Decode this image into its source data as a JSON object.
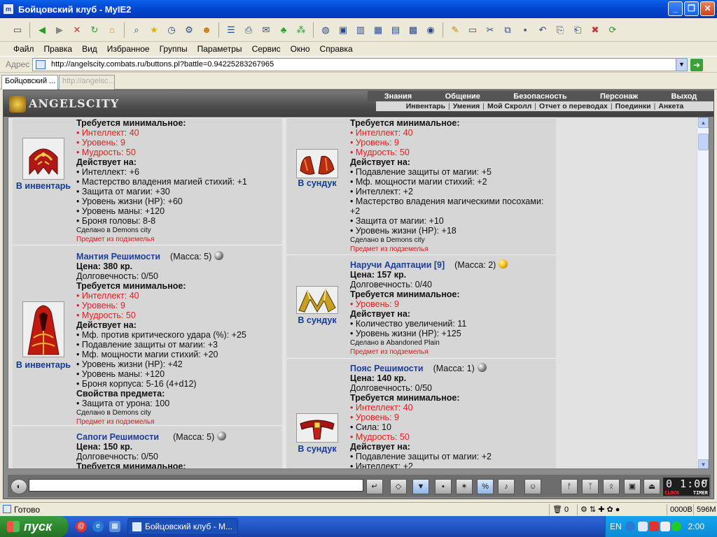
{
  "window": {
    "title": "Бойцовский клуб - MyIE2"
  },
  "menu": [
    "Файл",
    "Правка",
    "Вид",
    "Избранное",
    "Группы",
    "Параметры",
    "Сервис",
    "Окно",
    "Справка"
  ],
  "address": {
    "label": "Адрес",
    "url": "http://angelscity.combats.ru/buttons.pl?battle=0.94225283267965"
  },
  "tabs": [
    {
      "label": "Бойцовский ..."
    },
    {
      "label": "http://angelsc..."
    }
  ],
  "site": {
    "logo": "ANGELSCITY",
    "main_nav": [
      "Знания",
      "Общение",
      "Безопасность",
      "Персонаж",
      "Выход"
    ],
    "sub_nav": [
      "Инвентарь",
      "Умения",
      "Мой Скролл",
      "Отчет о переводах",
      "Поединки",
      "Анкета"
    ]
  },
  "items_left": [
    {
      "action": "В инвентарь",
      "req_header": "Требуется минимальное:",
      "reqs": [
        "Интеллект: 40",
        "Уровень: 9",
        "Мудрость: 50"
      ],
      "acts_header": "Действует на:",
      "acts": [
        "Интеллект: +6",
        "Мастерство владения магией стихий: +1",
        "Защита от магии: +30",
        "Уровень жизни (HP): +60",
        "Уровень маны: +120",
        "Броня головы: 8-8"
      ],
      "made_in": "Сделано в Demons city",
      "origin": "Предмет из подземелья"
    },
    {
      "action": "В инвентарь",
      "name": "Мантия Решимости",
      "mass": "(Масса: 5)",
      "price": "Цена: 380 кр.",
      "durability": "Долговечность: 0/50",
      "req_header": "Требуется минимальное:",
      "reqs": [
        "Интеллект: 40",
        "Уровень: 9",
        "Мудрость: 50"
      ],
      "acts_header": "Действует на:",
      "acts": [
        "Мф. против критического удара (%): +25",
        "Подавление защиты от магии: +3",
        "Мф. мощности магии стихий: +20",
        "Уровень жизни (HP): +42",
        "Уровень маны: +120",
        "Броня корпуса: 5-16 (4+d12)"
      ],
      "props_header": "Свойства предмета:",
      "props": [
        "Защита от урона: 100"
      ],
      "made_in": "Сделано в Demons city",
      "origin": "Предмет из подземелья"
    },
    {
      "name": "Сапоги Решимости",
      "mass": "(Масса: 5)",
      "price": "Цена: 150 кр.",
      "durability": "Долговечность: 0/50",
      "req_header": "Требуется минимальное:"
    }
  ],
  "items_right": [
    {
      "action": "В сундук",
      "req_header": "Требуется минимальное:",
      "reqs": [
        "Интеллект: 40",
        "Уровень: 9",
        "Мудрость: 50"
      ],
      "acts_header": "Действует на:",
      "acts": [
        "Подавление защиты от магии: +5",
        "Мф. мощности магии стихий: +2",
        "Интеллект: +2",
        "Мастерство владения магическими посохами: +2",
        "Защита от магии: +10",
        "Уровень жизни (HP): +18"
      ],
      "made_in": "Сделано в Demons city",
      "origin": "Предмет из подземелья"
    },
    {
      "action": "В сундук",
      "name": "Наручи Адаптации [9]",
      "mass": "(Масса: 2)",
      "price": "Цена: 157 кр.",
      "durability": "Долговечность: 0/40",
      "req_header": "Требуется минимальное:",
      "reqs": [
        "Уровень: 9"
      ],
      "acts_header": "Действует на:",
      "acts": [
        "Количество увеличений: 11",
        "Уровень жизни (HP): +125"
      ],
      "made_in": "Сделано в Abandoned Plain",
      "origin": "Предмет из подземелья"
    },
    {
      "action": "В сундук",
      "name": "Пояс Решимости",
      "mass": "(Масса: 1)",
      "price": "Цена: 140 кр.",
      "durability": "Долговечность: 0/50",
      "req_header": "Требуется минимальное:",
      "reqs_mixed": [
        {
          "t": "Интеллект: 40",
          "red": true
        },
        {
          "t": "Уровень: 9",
          "red": true
        },
        {
          "t": "Сила: 10",
          "red": false
        },
        {
          "t": "Мудрость: 50",
          "red": true
        }
      ],
      "acts_header": "Действует на:",
      "acts": [
        "Подавление защиты от магии: +2",
        "Интеллект: +2"
      ]
    }
  ],
  "clock": {
    "time": "0 1:00",
    "sec": "47",
    "clock_label": "CLOCK",
    "timer_label": "TIMER"
  },
  "status": {
    "text": "Готово",
    "trash": "0",
    "mem1": "0000B",
    "mem2": "596M"
  },
  "taskbar": {
    "start": "пуск",
    "task": "Бойцовский клуб - M...",
    "lang": "EN",
    "time": "2:00"
  },
  "colors": {
    "title_blue": "#0348d0",
    "item_name": "#1d3f99",
    "req_red": "#e02020",
    "panel_gray": "#d6d6d6"
  }
}
